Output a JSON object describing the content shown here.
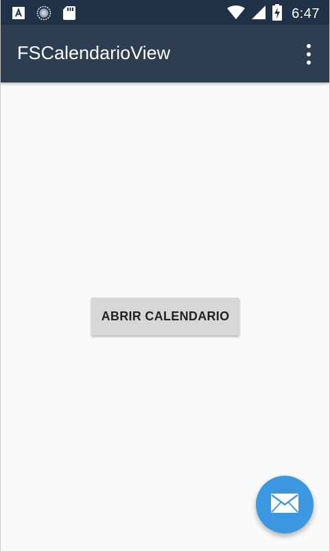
{
  "status_bar": {
    "time": "6:47",
    "icons": [
      "accessibility-a-icon",
      "sync-circle-icon",
      "sd-card-icon",
      "wifi-icon",
      "signal-icon",
      "battery-charging-icon"
    ]
  },
  "toolbar": {
    "title": "FSCalendarioView",
    "menu_icon": "more-vert-icon"
  },
  "main": {
    "open_calendar_label": "ABRIR CALENDARIO"
  },
  "fab": {
    "icon": "mail-icon",
    "color": "#3b98e0"
  },
  "colors": {
    "status_bar": "#1f3248",
    "toolbar": "#2d3e52",
    "background": "#fafafa",
    "button": "#d6d7d7"
  }
}
